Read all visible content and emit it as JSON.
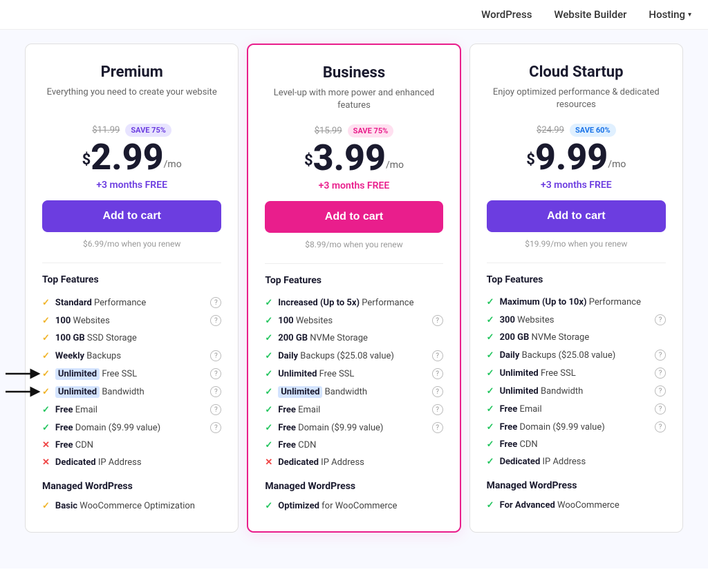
{
  "nav": {
    "items": [
      {
        "label": "WordPress",
        "active": false
      },
      {
        "label": "Website Builder",
        "active": false
      },
      {
        "label": "Hosting",
        "active": true,
        "hasChevron": true
      }
    ]
  },
  "plans": [
    {
      "id": "premium",
      "name": "Premium",
      "description": "Everything you need to create your website",
      "originalPrice": "$11.99",
      "saveBadge": "SAVE 75%",
      "saveBadgeStyle": "purple",
      "currentPrice": "2.99",
      "monthsFree": "+3 months FREE",
      "monthsFreeStyle": "purple",
      "addToCartLabel": "Add to cart",
      "addToCartStyle": "purple",
      "renewText": "$6.99/mo when you renew",
      "topFeaturesTitle": "Top Features",
      "features": [
        {
          "check": "yellow",
          "label": "Standard",
          "suffix": " Performance",
          "info": true
        },
        {
          "check": "yellow",
          "label": "100",
          "suffix": " Websites",
          "info": true
        },
        {
          "check": "yellow",
          "label": "100 GB",
          "suffix": " SSD Storage",
          "info": false
        },
        {
          "check": "yellow",
          "label": "Weekly",
          "suffix": " Backups",
          "info": true
        },
        {
          "check": "yellow",
          "label": "Unlimited",
          "suffix": " Free SSL",
          "info": true,
          "highlight": true
        },
        {
          "check": "yellow",
          "label": "Unlimited",
          "suffix": " Bandwidth",
          "info": true,
          "highlight": true
        },
        {
          "check": "green",
          "label": "Free",
          "suffix": " Email",
          "info": true
        },
        {
          "check": "green",
          "label": "Free",
          "suffix": " Domain ($9.99 value)",
          "info": true
        },
        {
          "check": "cross",
          "label": "Free",
          "suffix": " CDN",
          "info": false
        },
        {
          "check": "cross",
          "label": "Dedicated",
          "suffix": " IP Address",
          "info": false
        }
      ],
      "managedTitle": "Managed WordPress",
      "managedFeatures": [
        {
          "check": "yellow",
          "label": "Basic",
          "suffix": " WooCommerce Optimization"
        }
      ]
    },
    {
      "id": "business",
      "name": "Business",
      "description": "Level-up with more power and enhanced features",
      "originalPrice": "$15.99",
      "saveBadge": "SAVE 75%",
      "saveBadgeStyle": "pink",
      "currentPrice": "3.99",
      "monthsFree": "+3 months FREE",
      "monthsFreeStyle": "pink",
      "addToCartLabel": "Add to cart",
      "addToCartStyle": "pink",
      "renewText": "$8.99/mo when you renew",
      "topFeaturesTitle": "Top Features",
      "features": [
        {
          "check": "green",
          "label": "Increased (Up to 5x)",
          "suffix": " Performance",
          "info": false
        },
        {
          "check": "green",
          "label": "100",
          "suffix": " Websites",
          "info": true
        },
        {
          "check": "green",
          "label": "200 GB",
          "suffix": " NVMe Storage",
          "info": false
        },
        {
          "check": "green",
          "label": "Daily",
          "suffix": " Backups ($25.08 value)",
          "info": true
        },
        {
          "check": "green",
          "label": "Unlimited",
          "suffix": " Free SSL",
          "info": true
        },
        {
          "check": "green",
          "label": "Unlimited",
          "suffix": " Bandwidth",
          "info": true,
          "highlight": true
        },
        {
          "check": "green",
          "label": "Free",
          "suffix": " Email",
          "info": true
        },
        {
          "check": "green",
          "label": "Free",
          "suffix": " Domain ($9.99 value)",
          "info": true
        },
        {
          "check": "green",
          "label": "Free",
          "suffix": " CDN",
          "info": false
        },
        {
          "check": "cross",
          "label": "Dedicated",
          "suffix": " IP Address",
          "info": false
        }
      ],
      "managedTitle": "Managed WordPress",
      "managedFeatures": [
        {
          "check": "green",
          "label": "Optimized",
          "suffix": " for WooCommerce"
        }
      ]
    },
    {
      "id": "cloud-startup",
      "name": "Cloud Startup",
      "description": "Enjoy optimized performance & dedicated resources",
      "originalPrice": "$24.99",
      "saveBadge": "SAVE 60%",
      "saveBadgeStyle": "blue",
      "currentPrice": "9.99",
      "monthsFree": "+3 months FREE",
      "monthsFreeStyle": "purple",
      "addToCartLabel": "Add to cart",
      "addToCartStyle": "purple",
      "renewText": "$19.99/mo when you renew",
      "topFeaturesTitle": "Top Features",
      "features": [
        {
          "check": "green",
          "label": "Maximum (Up to 10x)",
          "suffix": " Performance",
          "info": false
        },
        {
          "check": "green",
          "label": "300",
          "suffix": " Websites",
          "info": true
        },
        {
          "check": "green",
          "label": "200 GB",
          "suffix": " NVMe Storage",
          "info": false
        },
        {
          "check": "green",
          "label": "Daily",
          "suffix": " Backups ($25.08 value)",
          "info": true
        },
        {
          "check": "green",
          "label": "Unlimited",
          "suffix": " Free SSL",
          "info": true
        },
        {
          "check": "green",
          "label": "Unlimited",
          "suffix": " Bandwidth",
          "info": true
        },
        {
          "check": "green",
          "label": "Free",
          "suffix": " Email",
          "info": true
        },
        {
          "check": "green",
          "label": "Free",
          "suffix": " Domain ($9.99 value)",
          "info": true
        },
        {
          "check": "green",
          "label": "Free",
          "suffix": " CDN",
          "info": false
        },
        {
          "check": "green",
          "label": "Dedicated",
          "suffix": " IP Address",
          "info": false
        }
      ],
      "managedTitle": "Managed WordPress",
      "managedFeatures": [
        {
          "check": "green",
          "label": "For Advanced",
          "suffix": " WooCommerce"
        }
      ]
    }
  ]
}
